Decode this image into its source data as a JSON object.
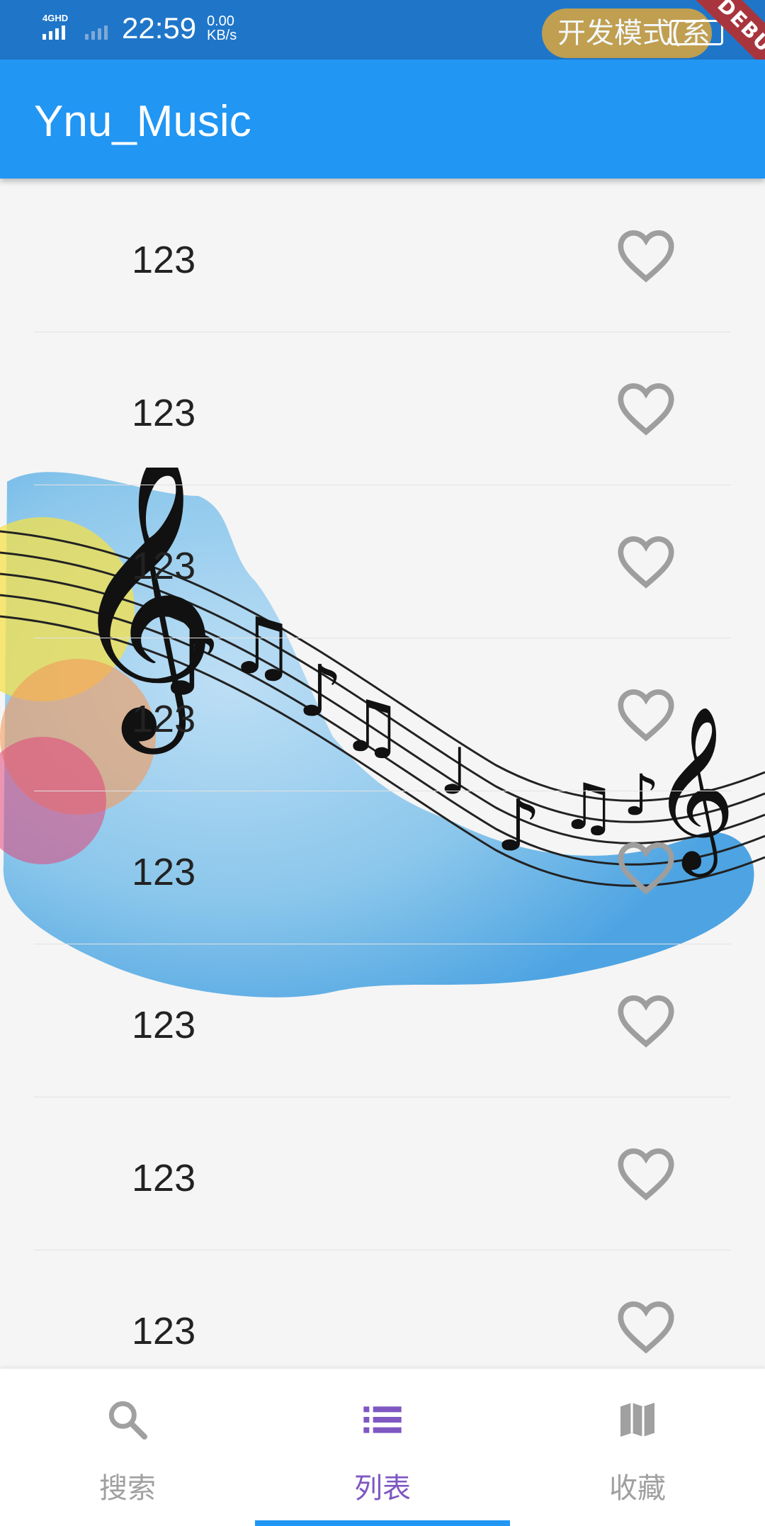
{
  "status_bar": {
    "network": "4GHD",
    "time": "22:59",
    "speed_value": "0.00",
    "speed_unit": "KB/s",
    "dev_mode_text": "开发模式(系",
    "debug_banner": "DEBUG"
  },
  "app_bar": {
    "title": "Ynu_Music"
  },
  "songs": [
    {
      "title": "123"
    },
    {
      "title": "123"
    },
    {
      "title": "123"
    },
    {
      "title": "123"
    },
    {
      "title": "123"
    },
    {
      "title": "123"
    },
    {
      "title": "123"
    },
    {
      "title": "123"
    }
  ],
  "bottom_nav": {
    "items": [
      {
        "label": "搜索",
        "icon": "search-icon"
      },
      {
        "label": "列表",
        "icon": "list-icon"
      },
      {
        "label": "收藏",
        "icon": "map-icon"
      }
    ],
    "active_index": 1
  },
  "colors": {
    "primary": "#2196f3",
    "status_bar": "#1f76c9",
    "active_nav": "#7e57c2",
    "inactive_nav": "#a0a0a0",
    "heart": "#9e9e9e"
  }
}
